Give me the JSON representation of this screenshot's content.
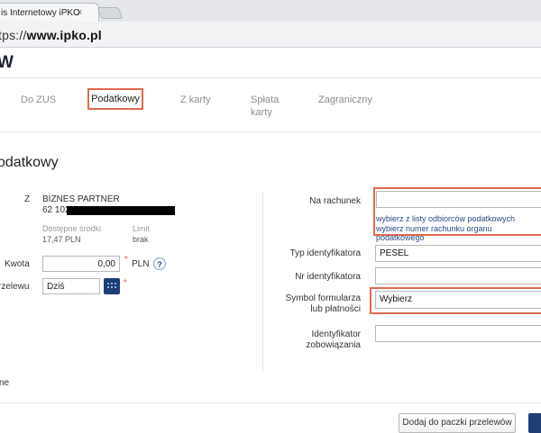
{
  "browser": {
    "tab_title": "is Internetowy iPKO",
    "tab_close": "×",
    "url_prefix": "tps://",
    "url_domain": "www.ipko.pl"
  },
  "page": {
    "logo_text": "W",
    "section_title": "odatkowy"
  },
  "transfer_tabs": [
    {
      "label": "Do ZUS"
    },
    {
      "label": "Podatkowy",
      "active": true
    },
    {
      "label": "Z karty"
    },
    {
      "label_line1": "Spłata",
      "label_line2": "karty"
    },
    {
      "label": "Zagraniczny"
    }
  ],
  "form_left": {
    "from_label": "Z",
    "account_name": "BIZNES PARTNER",
    "account_number_visible": "62 1020",
    "available_label": "Dostępne środki",
    "available_value": "17,47 PLN",
    "limit_label": "Limit",
    "limit_value": "brak",
    "amount_label": "Kwota",
    "amount_value": "0,00",
    "required_mark": "*",
    "currency": "PLN",
    "help_icon": "?",
    "date_label": "rzelewu",
    "date_value": "Dziś",
    "footer_fragment": "ne"
  },
  "form_right": {
    "account_label": "Na rachunek",
    "account_value": "",
    "link_choose_recipient": "wybierz z listy odbiorców podatkowych",
    "link_choose_number": "wybierz numer rachunku organu podatkowego",
    "id_type_label": "Typ identyfikatora",
    "id_type_value": "PESEL",
    "id_number_label": "Nr identyfikatora",
    "id_number_value": "",
    "form_symbol_label_line1": "Symbol formularza",
    "form_symbol_label_line2": "lub płatności",
    "form_symbol_value": "Wybierz",
    "liability_label_line1": "Identyfikator",
    "liability_label_line2": "zobowiązania",
    "liability_value": ""
  },
  "actions": {
    "add_to_batch": "Dodaj do paczki przelewów"
  },
  "colors": {
    "highlight": "#e0684f",
    "brand_navy": "#1f3e73",
    "link": "#2b4b86"
  }
}
